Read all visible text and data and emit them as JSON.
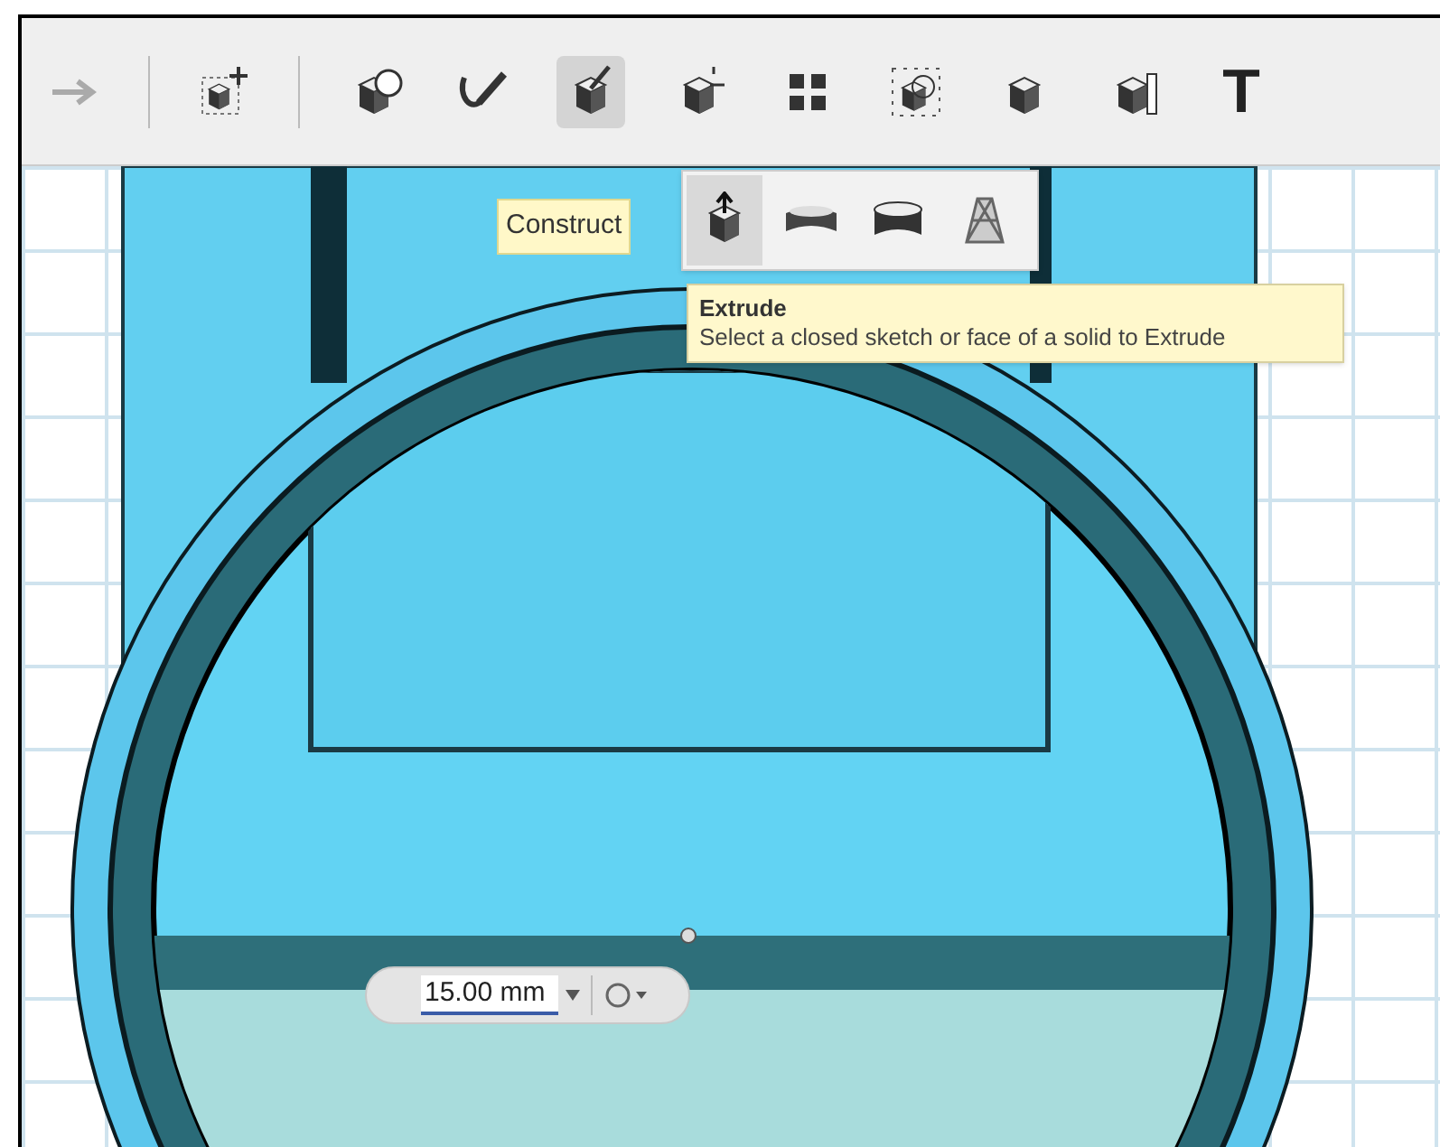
{
  "toolbar": {
    "items": [
      {
        "kind": "button",
        "selected": false
      },
      {
        "kind": "separator"
      },
      {
        "kind": "button",
        "selected": false
      },
      {
        "kind": "separator"
      },
      {
        "kind": "button",
        "selected": false
      },
      {
        "kind": "button",
        "selected": false
      },
      {
        "kind": "button",
        "selected": true
      },
      {
        "kind": "button",
        "selected": false
      },
      {
        "kind": "button",
        "selected": false
      },
      {
        "kind": "button",
        "selected": false
      },
      {
        "kind": "button",
        "selected": false
      },
      {
        "kind": "button",
        "selected": false
      },
      {
        "kind": "text",
        "label": "T",
        "selected": false
      }
    ]
  },
  "flyout": {
    "label": "Construct",
    "items": [
      {
        "selected": true
      },
      {
        "selected": false
      },
      {
        "selected": false
      },
      {
        "selected": false
      }
    ]
  },
  "tooltip": {
    "title": "Extrude",
    "description": "Select a closed sketch or face of a solid to Extrude"
  },
  "dimension_input": {
    "value": "15.00 mm"
  }
}
